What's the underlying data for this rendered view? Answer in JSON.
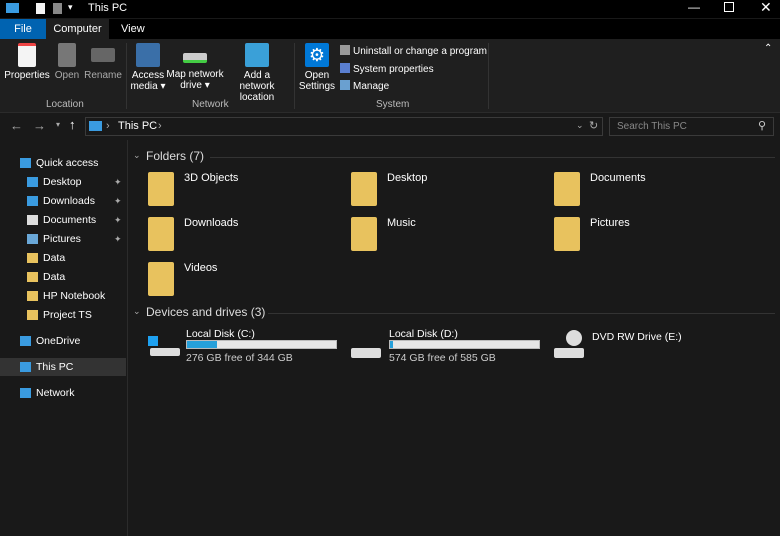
{
  "window": {
    "title": "This PC",
    "controls": [
      "minimize",
      "maximize",
      "close"
    ]
  },
  "tabs": [
    {
      "label": "File"
    },
    {
      "label": "Computer"
    },
    {
      "label": "View"
    }
  ],
  "ribbon": {
    "location": {
      "label": "Location",
      "buttons": [
        {
          "label": "Properties"
        },
        {
          "label": "Open"
        },
        {
          "label": "Rename"
        }
      ]
    },
    "network": {
      "label": "Network",
      "buttons": [
        {
          "label": "Access media ▾"
        },
        {
          "label": "Map network drive ▾"
        },
        {
          "label": "Add a network location"
        }
      ]
    },
    "system": {
      "label": "System",
      "open_settings": "Open Settings",
      "items": [
        {
          "label": "Uninstall or change a program"
        },
        {
          "label": "System properties"
        },
        {
          "label": "Manage"
        }
      ]
    }
  },
  "address": {
    "path": "This PC",
    "search_placeholder": "Search This PC"
  },
  "sidebar": {
    "items": [
      {
        "label": "Quick access",
        "icon": "star-icon"
      },
      {
        "label": "Desktop",
        "icon": "desktop-icon",
        "pinned": true
      },
      {
        "label": "Downloads",
        "icon": "download-icon",
        "pinned": true
      },
      {
        "label": "Documents",
        "icon": "documents-icon",
        "pinned": true
      },
      {
        "label": "Pictures",
        "icon": "pictures-icon",
        "pinned": true
      },
      {
        "label": "Data",
        "icon": "folder-icon"
      },
      {
        "label": "Data",
        "icon": "folder-icon"
      },
      {
        "label": "HP Notebook",
        "icon": "folder-icon"
      },
      {
        "label": "Project TS",
        "icon": "folder-icon"
      },
      {
        "label": "OneDrive",
        "icon": "cloud-icon"
      },
      {
        "label": "This PC",
        "icon": "computer-icon",
        "selected": true
      },
      {
        "label": "Network",
        "icon": "network-icon"
      }
    ]
  },
  "folders": {
    "header": "Folders (7)",
    "items": [
      {
        "label": "3D Objects"
      },
      {
        "label": "Desktop"
      },
      {
        "label": "Documents"
      },
      {
        "label": "Downloads"
      },
      {
        "label": "Music"
      },
      {
        "label": "Pictures"
      },
      {
        "label": "Videos"
      }
    ]
  },
  "drives": {
    "header": "Devices and drives (3)",
    "items": [
      {
        "label": "Local Disk (C:)",
        "free": "276 GB free of 344 GB",
        "used_fraction": 0.198
      },
      {
        "label": "Local Disk (D:)",
        "free": "574 GB free of 585 GB",
        "used_fraction": 0.019
      },
      {
        "label": "DVD RW Drive (E:)"
      }
    ]
  },
  "colors": {
    "accent": "#0063b1",
    "bar": "#26a0da",
    "folder": "#e8c25e"
  }
}
